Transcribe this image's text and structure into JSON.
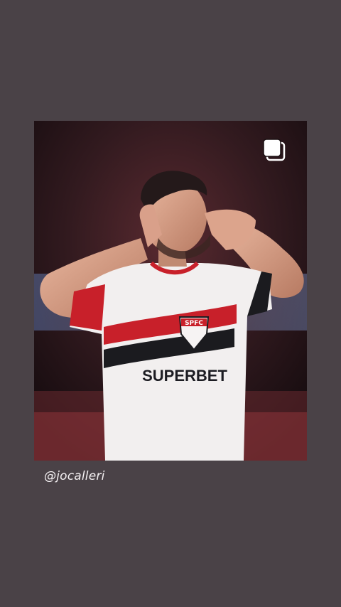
{
  "story": {
    "mention": "@jocalleri",
    "photo": {
      "subject": "football-player-celebrating",
      "shirt_sponsor": "SUPERBET",
      "crest_text": "SPFC",
      "colors": {
        "background": "#4a4247",
        "shirt": "#f2efef",
        "stripe_red": "#c8202a",
        "stripe_black": "#1b1b1f"
      }
    },
    "icons": [
      "multiple-images-icon"
    ]
  }
}
